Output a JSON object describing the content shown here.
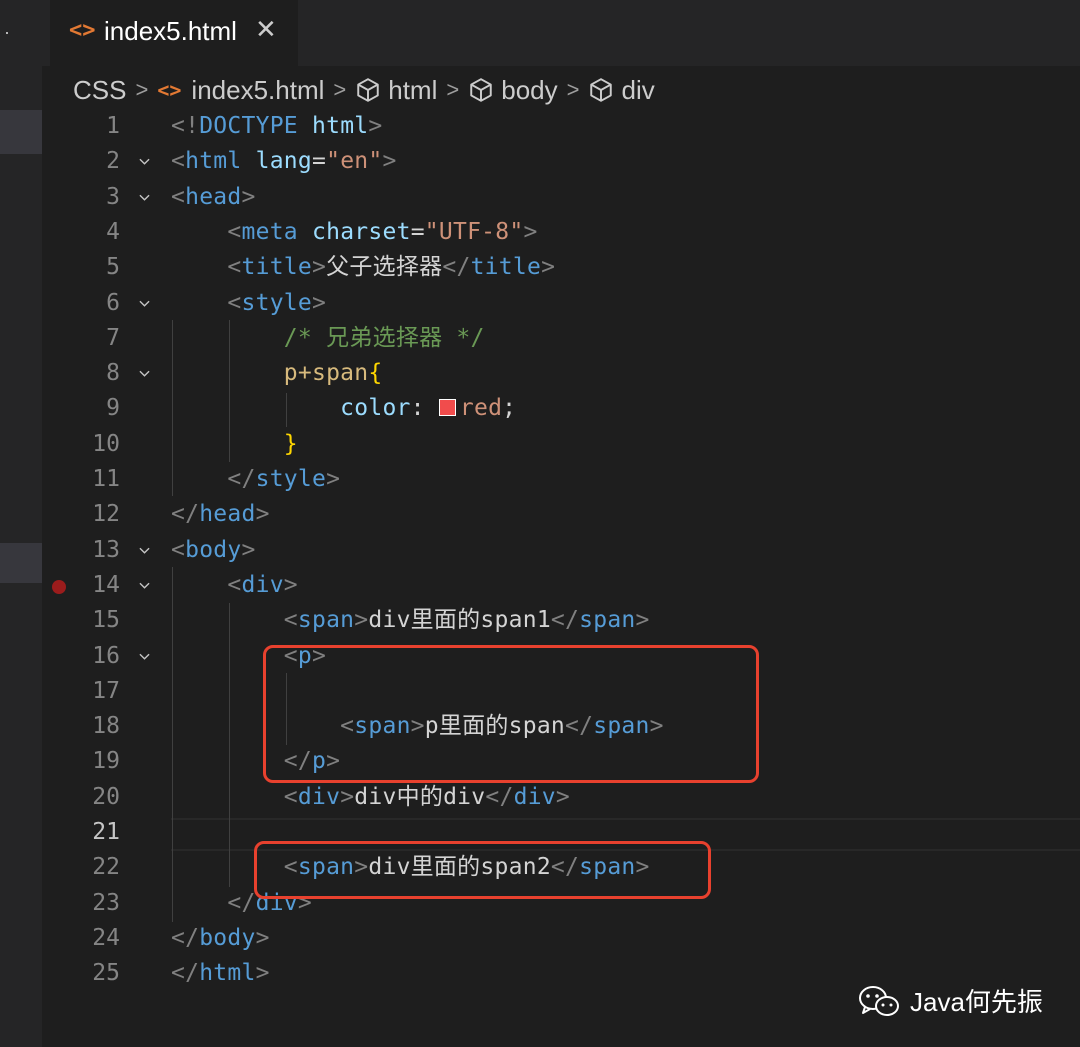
{
  "tab": {
    "title": "index5.html",
    "close": "✕"
  },
  "breadcrumb": [
    "CSS",
    "index5.html",
    "html",
    "body",
    "div"
  ],
  "code_lines": [
    {
      "n": "1",
      "parts": [
        [
          "br",
          "<!"
        ],
        [
          "tag",
          "DOCTYPE"
        ],
        [
          "txt",
          " "
        ],
        [
          "attr",
          "html"
        ],
        [
          "br",
          ">"
        ]
      ]
    },
    {
      "n": "2",
      "parts": [
        [
          "br",
          "<"
        ],
        [
          "tag",
          "html"
        ],
        [
          "txt",
          " "
        ],
        [
          "attr",
          "lang"
        ],
        [
          "txt",
          "="
        ],
        [
          "str",
          "\"en\""
        ],
        [
          "br",
          ">"
        ]
      ]
    },
    {
      "n": "3",
      "parts": [
        [
          "br",
          "<"
        ],
        [
          "tag",
          "head"
        ],
        [
          "br",
          ">"
        ]
      ]
    },
    {
      "n": "4",
      "parts": [
        [
          "txt",
          "    "
        ],
        [
          "br",
          "<"
        ],
        [
          "tag",
          "meta"
        ],
        [
          "txt",
          " "
        ],
        [
          "attr",
          "charset"
        ],
        [
          "txt",
          "="
        ],
        [
          "str",
          "\"UTF-8\""
        ],
        [
          "br",
          ">"
        ]
      ]
    },
    {
      "n": "5",
      "parts": [
        [
          "txt",
          "    "
        ],
        [
          "br",
          "<"
        ],
        [
          "tag",
          "title"
        ],
        [
          "br",
          ">"
        ],
        [
          "txt",
          "父子选择器"
        ],
        [
          "br",
          "</"
        ],
        [
          "tag",
          "title"
        ],
        [
          "br",
          ">"
        ]
      ]
    },
    {
      "n": "6",
      "parts": [
        [
          "txt",
          "    "
        ],
        [
          "br",
          "<"
        ],
        [
          "tag",
          "style"
        ],
        [
          "br",
          ">"
        ]
      ]
    },
    {
      "n": "7",
      "parts": [
        [
          "txt",
          "        "
        ],
        [
          "cmt",
          "/* 兄弟选择器 */"
        ]
      ]
    },
    {
      "n": "8",
      "parts": [
        [
          "txt",
          "        "
        ],
        [
          "sel",
          "p+span"
        ],
        [
          "brace",
          "{"
        ]
      ]
    },
    {
      "n": "9",
      "parts": [
        [
          "txt",
          "            "
        ],
        [
          "attr",
          "color"
        ],
        [
          "txt",
          ": "
        ],
        [
          "swatch",
          ""
        ],
        [
          "val",
          "red"
        ],
        [
          "txt",
          ";"
        ]
      ]
    },
    {
      "n": "10",
      "parts": [
        [
          "txt",
          "        "
        ],
        [
          "brace",
          "}"
        ]
      ]
    },
    {
      "n": "11",
      "parts": [
        [
          "txt",
          "    "
        ],
        [
          "br",
          "</"
        ],
        [
          "tag",
          "style"
        ],
        [
          "br",
          ">"
        ]
      ]
    },
    {
      "n": "12",
      "parts": [
        [
          "br",
          "</"
        ],
        [
          "tag",
          "head"
        ],
        [
          "br",
          ">"
        ]
      ]
    },
    {
      "n": "13",
      "parts": [
        [
          "br",
          "<"
        ],
        [
          "tag",
          "body"
        ],
        [
          "br",
          ">"
        ]
      ]
    },
    {
      "n": "14",
      "parts": [
        [
          "txt",
          "    "
        ],
        [
          "br",
          "<"
        ],
        [
          "tag",
          "div"
        ],
        [
          "br",
          ">"
        ]
      ]
    },
    {
      "n": "15",
      "parts": [
        [
          "txt",
          "        "
        ],
        [
          "br",
          "<"
        ],
        [
          "tag",
          "span"
        ],
        [
          "br",
          ">"
        ],
        [
          "txt",
          "div里面的span1"
        ],
        [
          "br",
          "</"
        ],
        [
          "tag",
          "span"
        ],
        [
          "br",
          ">"
        ]
      ]
    },
    {
      "n": "16",
      "parts": [
        [
          "txt",
          "        "
        ],
        [
          "br",
          "<"
        ],
        [
          "tag",
          "p"
        ],
        [
          "br",
          ">"
        ]
      ]
    },
    {
      "n": "17",
      "parts": []
    },
    {
      "n": "18",
      "parts": [
        [
          "txt",
          "            "
        ],
        [
          "br",
          "<"
        ],
        [
          "tag",
          "span"
        ],
        [
          "br",
          ">"
        ],
        [
          "txt",
          "p里面的span"
        ],
        [
          "br",
          "</"
        ],
        [
          "tag",
          "span"
        ],
        [
          "br",
          ">"
        ]
      ]
    },
    {
      "n": "19",
      "parts": [
        [
          "txt",
          "        "
        ],
        [
          "br",
          "</"
        ],
        [
          "tag",
          "p"
        ],
        [
          "br",
          ">"
        ]
      ]
    },
    {
      "n": "20",
      "parts": [
        [
          "txt",
          "        "
        ],
        [
          "br",
          "<"
        ],
        [
          "tag",
          "div"
        ],
        [
          "br",
          ">"
        ],
        [
          "txt",
          "div中的div"
        ],
        [
          "br",
          "</"
        ],
        [
          "tag",
          "div"
        ],
        [
          "br",
          ">"
        ]
      ]
    },
    {
      "n": "21",
      "parts": []
    },
    {
      "n": "22",
      "parts": [
        [
          "txt",
          "        "
        ],
        [
          "br",
          "<"
        ],
        [
          "tag",
          "span"
        ],
        [
          "br",
          ">"
        ],
        [
          "txt",
          "div里面的span2"
        ],
        [
          "br",
          "</"
        ],
        [
          "tag",
          "span"
        ],
        [
          "br",
          ">"
        ]
      ]
    },
    {
      "n": "23",
      "parts": [
        [
          "txt",
          "    "
        ],
        [
          "br",
          "</"
        ],
        [
          "tag",
          "div"
        ],
        [
          "br",
          ">"
        ]
      ]
    },
    {
      "n": "24",
      "parts": [
        [
          "br",
          "</"
        ],
        [
          "tag",
          "body"
        ],
        [
          "br",
          ">"
        ]
      ]
    },
    {
      "n": "25",
      "parts": [
        [
          "br",
          "</"
        ],
        [
          "tag",
          "html"
        ],
        [
          "br",
          ">"
        ]
      ]
    }
  ],
  "folded_lines": [
    "2",
    "3",
    "6",
    "8",
    "13",
    "14",
    "16"
  ],
  "active_line": "21",
  "breakpoint_line": "14",
  "watermark": {
    "text": "Java何先振",
    "icon": "wechat-icon"
  },
  "colors": {
    "highlight_box": "#e8412e",
    "swatch_red": "#f14c4c",
    "file_icon": "#e37933"
  }
}
